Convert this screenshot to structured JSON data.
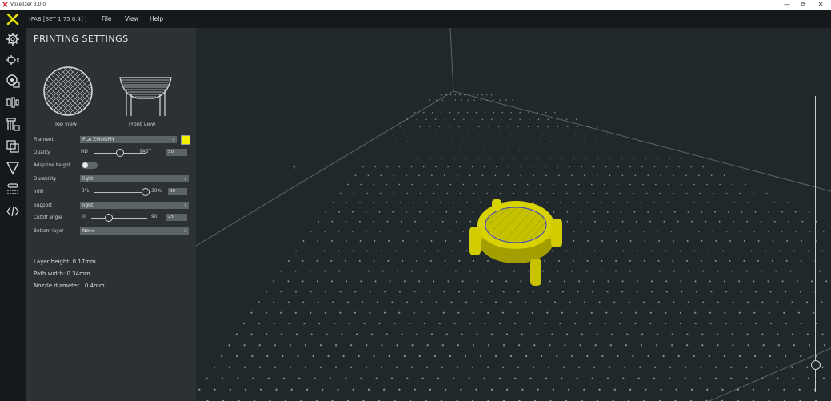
{
  "window": {
    "title": "VoxelIzer 3.0.0",
    "controls": {
      "minimize": "—",
      "maximize": "⧉",
      "close": "✕"
    }
  },
  "menubar": {
    "preset": "(FAB [SET 1.75 0.4] )",
    "items": [
      "File",
      "View",
      "Help"
    ]
  },
  "toolbar": {
    "icons": [
      "printer-settings-icon",
      "advanced-settings-icon",
      "material-icon",
      "model-icon",
      "support-icon",
      "copies-icon",
      "filter-icon",
      "layers-icon",
      "gcode-icon"
    ]
  },
  "panel": {
    "title": "PRINTING SETTINGS",
    "top_view_label": "Top view",
    "front_view_label": "Front view",
    "filament": {
      "label": "Filament",
      "value": "PLA ZMORPH",
      "color": "#f3f000"
    },
    "quality": {
      "label": "Quality",
      "min_label": "HD",
      "max_label": "FAST",
      "value": "50"
    },
    "adaptive_height": {
      "label": "Adaptive height"
    },
    "durability": {
      "label": "Durability",
      "value": "light"
    },
    "infill": {
      "label": "Infill",
      "min_label": "3%",
      "max_label": "30%",
      "value": "30"
    },
    "support": {
      "label": "Support",
      "value": "light"
    },
    "cutoff": {
      "label": "Cutoff angle",
      "min_label": "0",
      "max_label": "90",
      "value": "25"
    },
    "bottom_layer": {
      "label": "Bottom layer",
      "value": "None"
    },
    "info": {
      "layer_height": "Layer height: 0.17mm",
      "path_width": "Path width: 0.34mm",
      "nozzle": "Nozzle diameter : 0.4mm"
    }
  },
  "viewport": {
    "axis_label": "Y"
  },
  "colors": {
    "accent": "#f3f000",
    "model": "#d8d200",
    "panel_bg": "#2b3135",
    "viewport_bg": "#20282c"
  }
}
